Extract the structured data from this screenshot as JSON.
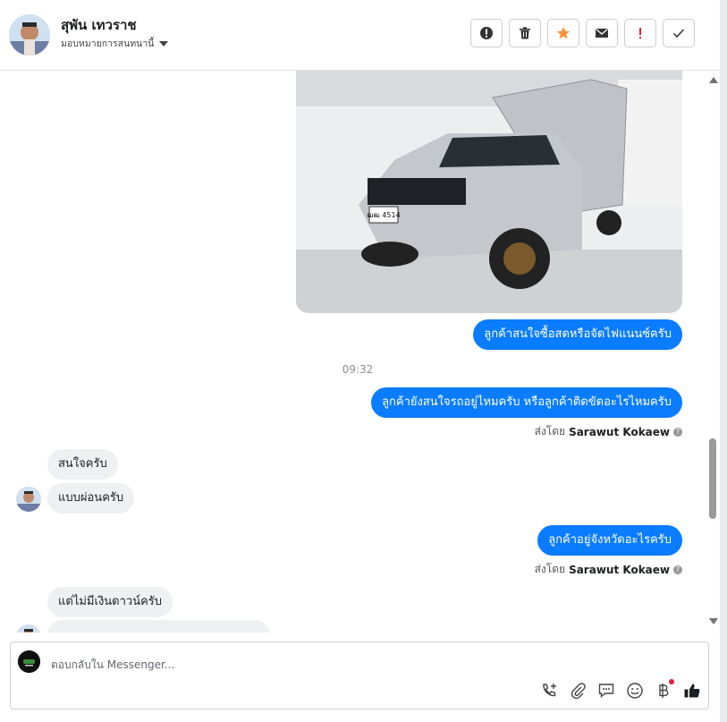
{
  "header": {
    "contact_name": "สุพัน เทวราช",
    "assign_label": "มอบหมายการสนทนานี้",
    "tools": [
      {
        "name": "spam-alert-button",
        "icon": "alert-circle-icon"
      },
      {
        "name": "delete-button",
        "icon": "trash-icon"
      },
      {
        "name": "follow-up-button",
        "icon": "star-icon"
      },
      {
        "name": "mark-unread-button",
        "icon": "envelope-icon"
      },
      {
        "name": "mark-important-button",
        "icon": "exclamation-icon"
      },
      {
        "name": "mark-done-button",
        "icon": "check-icon"
      }
    ]
  },
  "conversation": {
    "msg_interest": "ลูกค้าสนใจซื้อสดหรือจัดไฟแนนซ์ครับ",
    "timestamp": "09:32",
    "msg_still_interested": "ลูกค้ายังสนใจรถอยู่ไหมครับ หรือลูกค้าติดขัดอะไรไหมครับ",
    "sent_by_prefix": "ส่งโดย",
    "sent_by_name": "Sarawut Kokaew",
    "reply_interested": "สนใจครับ",
    "reply_installment": "แบบผ่อนครับ",
    "msg_province": "ลูกค้าอยู่จังหวัดอะไรครับ",
    "reply_no_down": "แต่ไม่มีเงินดาวน์ครับ",
    "plate_text": "ฒฒ 4514"
  },
  "composer": {
    "placeholder": "ตอบกลับใน Messenger...",
    "actions": [
      "call-add-icon",
      "attachment-icon",
      "saved-reply-icon",
      "emoji-icon",
      "baht-payment-icon",
      "thumbs-up-icon"
    ]
  },
  "colors": {
    "accent": "#0a7cff",
    "incoming_bubble": "#eef0f2",
    "star": "#f7923a",
    "important": "#e41e3f"
  }
}
